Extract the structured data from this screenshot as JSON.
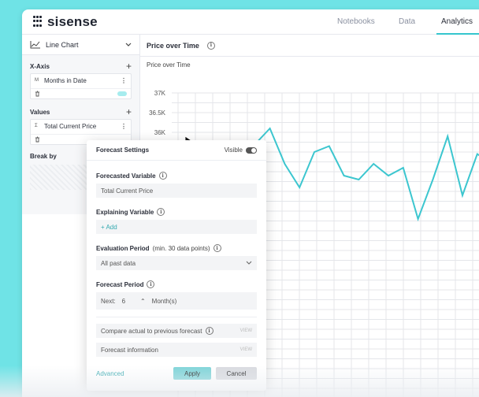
{
  "app": {
    "logo_text": "sisense"
  },
  "nav": {
    "tabs": [
      "Notebooks",
      "Data",
      "Analytics"
    ],
    "active": "Analytics"
  },
  "sidebar": {
    "chart_type": "Line Chart",
    "xaxis": {
      "label": "X-Axis",
      "field_type": "M",
      "field": "Months in Date"
    },
    "values": {
      "label": "Values",
      "field_type": "Σ",
      "field": "Total Current Price"
    },
    "breakby": "Break by"
  },
  "chart": {
    "header_title": "Price over Time",
    "inner_title": "Price over Time",
    "colors": {
      "line": "#3cc6cf",
      "grid": "#e4e6ea"
    }
  },
  "forecast": {
    "title": "Forecast Settings",
    "visible_label": "Visible",
    "forecasted_variable_label": "Forecasted Variable",
    "forecasted_variable_value": "Total Current Price",
    "explaining_variable_label": "Explaining Variable",
    "add_label": "+ Add",
    "evaluation_period_label": "Evaluation Period",
    "evaluation_period_sub": "(min. 30 data points)",
    "evaluation_period_value": "All past data",
    "forecast_period_label": "Forecast Period",
    "next_label": "Next:",
    "next_value": "6",
    "unit_label": "Month(s)",
    "compare_label": "Compare actual to previous forecast",
    "compare_link": "VIEW",
    "info_label": "Forecast information",
    "info_link": "VIEW",
    "advanced_label": "Advanced",
    "apply_label": "Apply",
    "cancel_label": "Cancel"
  },
  "chart_data": {
    "type": "line",
    "title": "Price over Time",
    "y_ticks": [
      "37K",
      "36.5K",
      "36K"
    ],
    "ylim": [
      34000,
      37000
    ],
    "grid": true,
    "series": [
      {
        "values": [
          35200,
          35700,
          36100,
          35200,
          34600,
          35500,
          35650,
          34900,
          34800,
          35200,
          34900,
          35100,
          33800,
          34800,
          35900,
          34400,
          35450,
          35200,
          34500
        ]
      }
    ]
  }
}
